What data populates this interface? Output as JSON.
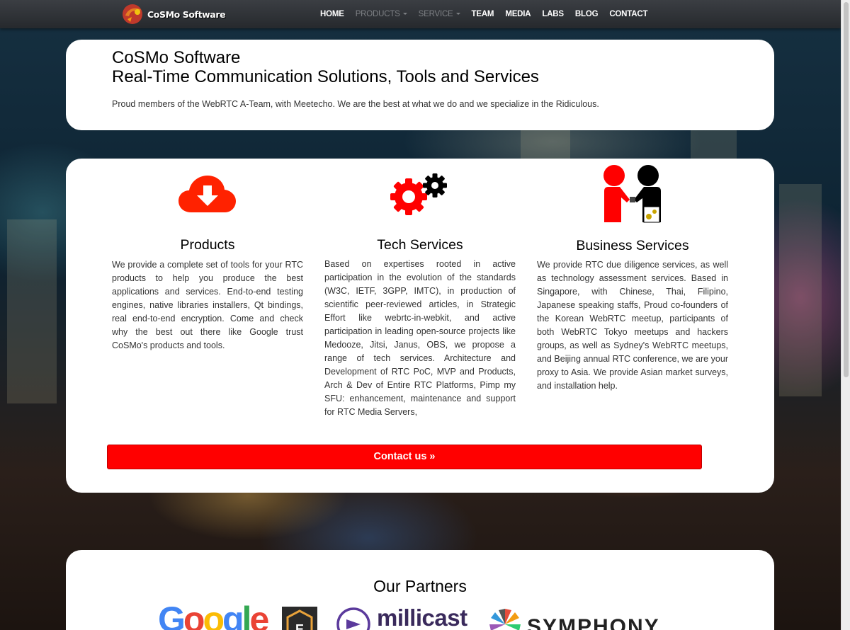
{
  "navbar": {
    "brand_name": "CoSMo Software",
    "items": [
      {
        "label": "HOME"
      },
      {
        "label": "PRODUCTS"
      },
      {
        "label": "SERVICE"
      },
      {
        "label": "TEAM"
      },
      {
        "label": "MEDIA"
      },
      {
        "label": "LABS"
      },
      {
        "label": "BLOG"
      },
      {
        "label": "CONTACT"
      }
    ]
  },
  "hero": {
    "title_line1": "CoSMo Software",
    "title_line2": "Real-Time Communication Solutions, Tools and Services",
    "tagline": "Proud members of the WebRTC A-Team, with Meetecho. We are the best at what we do and we specialize in the Ridiculous."
  },
  "services": [
    {
      "icon": "cloud-download-icon",
      "title": "Products",
      "text": "We provide a complete set of tools for your RTC products to help you produce the best applications and services. End-to-end testing engines, native libraries installers, Qt bindings, real end-to-end encryption. Come and check why the best out there like Google trust CoSMo's products and tools."
    },
    {
      "icon": "gears-icon",
      "title": "Tech Services",
      "text": "Based on expertises rooted in active participation in the evolution of the standards (W3C, IETF, 3GPP, IMTC), in production of scientific peer-reviewed articles, in Strategic Effort like webrtc-in-webkit, and active participation in leading open-source projects like Medooze, Jitsi, Janus, OBS, we propose a range of tech services. Architecture and Development of RTC PoC, MVP and Products, Arch & Dev of Entire RTC Platforms, Pimp my SFU: enhancement, maintenance and support for RTC Media Servers,"
    },
    {
      "icon": "handshake-icon",
      "title": "Business Services",
      "text": "We provide RTC due diligence services, as well as technology assessment services. Based in Singapore, with Chinese, Thai, Filipino, Japanese speaking staffs, Proud co-founders of the Korean WebRTC meetup, participants of both WebRTC Tokyo meetups and hackers groups, as well as Sydney's WebRTC meetups, and Beijing annual RTC conference, we are your proxy to Asia. We provide Asian market surveys, and installation help."
    }
  ],
  "cta": {
    "label": "Contact us »"
  },
  "partners": {
    "title": "Our Partners",
    "logos": [
      {
        "name": "Google",
        "text": "Google"
      },
      {
        "name": "E",
        "text": "E"
      },
      {
        "name": "millicast",
        "text": "millicast"
      },
      {
        "name": "Symphony",
        "text": "SYMPHONY"
      }
    ]
  },
  "colors": {
    "accent_red": "#ff0000",
    "navbar_bg": "#2e3135",
    "muted_nav": "#7d8084"
  }
}
